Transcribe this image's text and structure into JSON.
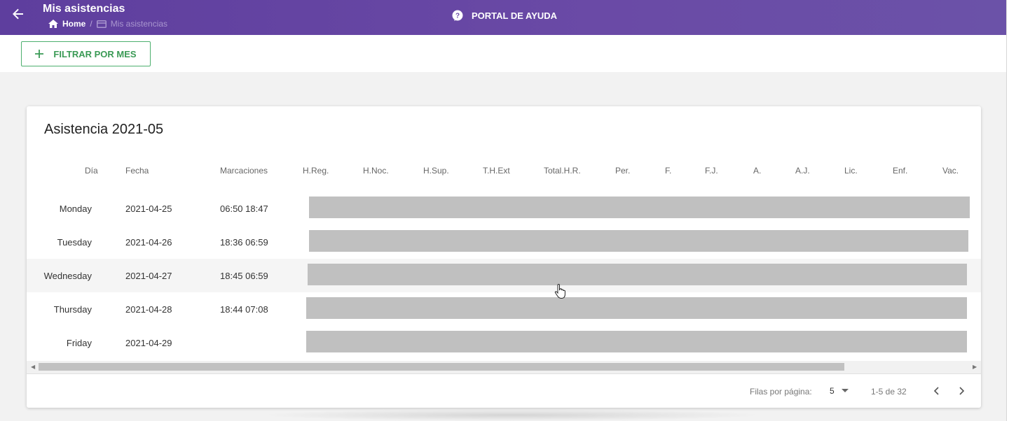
{
  "header": {
    "title": "Mis asistencias",
    "breadcrumb": {
      "home": "Home",
      "current": "Mis asistencias"
    },
    "help_label": "PORTAL DE AYUDA"
  },
  "toolbar": {
    "filter_label": "FILTRAR POR MES"
  },
  "card": {
    "title": "Asistencia 2021-05",
    "columns": [
      "Día",
      "Fecha",
      "Marcaciones",
      "H.Reg.",
      "H.Noc.",
      "H.Sup.",
      "T.H.Ext",
      "Total.H.R.",
      "Per.",
      "F.",
      "F.J.",
      "A.",
      "A.J.",
      "Lic.",
      "Enf.",
      "Vac."
    ],
    "rows": [
      {
        "day": "Monday",
        "date": "2021-04-25",
        "marks": "06:50 18:47"
      },
      {
        "day": "Tuesday",
        "date": "2021-04-26",
        "marks": "18:36 06:59"
      },
      {
        "day": "Wednesday",
        "date": "2021-04-27",
        "marks": "18:45 06:59"
      },
      {
        "day": "Thursday",
        "date": "2021-04-28",
        "marks": "18:44 07:08"
      },
      {
        "day": "Friday",
        "date": "2021-04-29",
        "marks": ""
      }
    ],
    "pagination": {
      "rows_per_page_label": "Filas por página:",
      "rows_per_page": "5",
      "range": "1-5 de 32"
    }
  },
  "colors": {
    "header_purple": "#5e3e9e",
    "filter_green": "#3a9a55",
    "redacted_gray": "#c0c0c0"
  }
}
